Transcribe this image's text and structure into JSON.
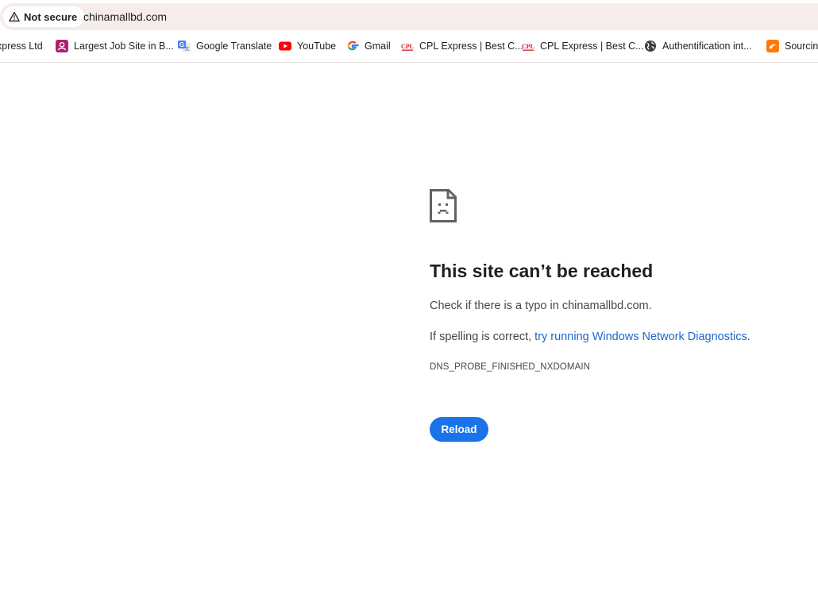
{
  "address_bar": {
    "security_label": "Not secure",
    "url": "chinamallbd.com"
  },
  "bookmarks": [
    {
      "label": "xpress Ltd",
      "icon": "none"
    },
    {
      "label": "Largest Job Site in B...",
      "icon": "job-site-icon"
    },
    {
      "label": "Google Translate",
      "icon": "google-translate-icon"
    },
    {
      "label": "YouTube",
      "icon": "youtube-icon"
    },
    {
      "label": "Gmail",
      "icon": "google-icon"
    },
    {
      "label": "CPL Express | Best C...",
      "icon": "cpl-icon"
    },
    {
      "label": "CPL Express | Best C...",
      "icon": "cpl-icon"
    },
    {
      "label": "Authentification int...",
      "icon": "globe-icon"
    },
    {
      "label": "Sourcing",
      "icon": "alibaba-icon"
    }
  ],
  "error_page": {
    "icon": "sad-page-icon",
    "title": "This site can’t be reached",
    "typo_text": "Check if there is a typo in chinamallbd.com.",
    "spelling_prefix": "If spelling is correct, ",
    "diagnostics_link": "try running Windows Network Diagnostics",
    "spelling_suffix": ".",
    "error_code": "DNS_PROBE_FINISHED_NXDOMAIN",
    "reload_label": "Reload"
  },
  "colors": {
    "accent": "#1a73e8",
    "link": "#1a68c8",
    "omnibox_bg": "#f6ecec"
  }
}
